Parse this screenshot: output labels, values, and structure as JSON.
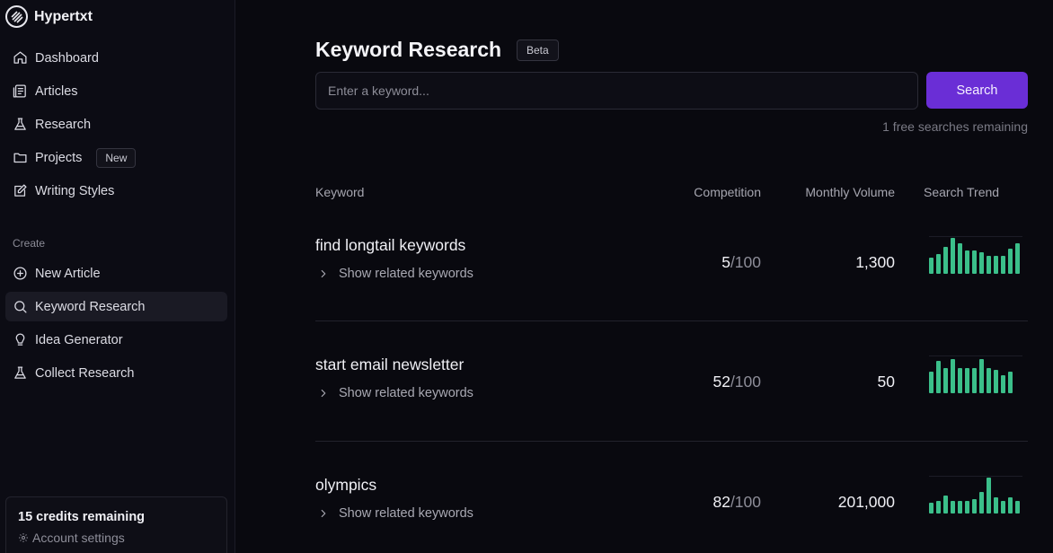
{
  "app": {
    "name": "Hypertxt"
  },
  "sidebar": {
    "nav": [
      {
        "label": "Dashboard",
        "icon": "home-icon"
      },
      {
        "label": "Articles",
        "icon": "articles-icon"
      },
      {
        "label": "Research",
        "icon": "flask-icon"
      },
      {
        "label": "Projects",
        "icon": "folder-icon",
        "badge": "New"
      },
      {
        "label": "Writing Styles",
        "icon": "edit-icon"
      }
    ],
    "create_label": "Create",
    "create": [
      {
        "label": "New Article",
        "icon": "plus-circle-icon"
      },
      {
        "label": "Keyword Research",
        "icon": "search-icon",
        "active": true
      },
      {
        "label": "Idea Generator",
        "icon": "lightbulb-icon"
      },
      {
        "label": "Collect Research",
        "icon": "flask-icon"
      }
    ],
    "credits": "15 credits remaining",
    "account_settings": "Account settings"
  },
  "main": {
    "title": "Keyword Research",
    "badge": "Beta",
    "search": {
      "placeholder": "Enter a keyword...",
      "value": "",
      "button": "Search"
    },
    "free_searches": "1 free searches remaining",
    "columns": {
      "keyword": "Keyword",
      "competition": "Competition",
      "volume": "Monthly Volume",
      "trend": "Search Trend"
    },
    "show_related_label": "Show related keywords",
    "rows": [
      {
        "keyword": "find longtail keywords",
        "competition": "5",
        "competition_max": "/100",
        "volume": "1,300",
        "trend": [
          0.45,
          0.55,
          0.75,
          1.0,
          0.85,
          0.65,
          0.65,
          0.6,
          0.5,
          0.5,
          0.5,
          0.7,
          0.85
        ]
      },
      {
        "keyword": "start email newsletter",
        "competition": "52",
        "competition_max": "/100",
        "volume": "50",
        "trend": [
          0.6,
          0.9,
          0.7,
          0.95,
          0.7,
          0.7,
          0.7,
          0.95,
          0.7,
          0.65,
          0.5,
          0.6
        ]
      },
      {
        "keyword": "olympics",
        "competition": "82",
        "competition_max": "/100",
        "volume": "201,000",
        "trend": [
          0.3,
          0.35,
          0.5,
          0.35,
          0.35,
          0.35,
          0.4,
          0.6,
          1.0,
          0.45,
          0.35,
          0.45,
          0.35
        ]
      }
    ],
    "trend_color": "#3bbf8a",
    "accent_color": "#6a2ed6"
  }
}
